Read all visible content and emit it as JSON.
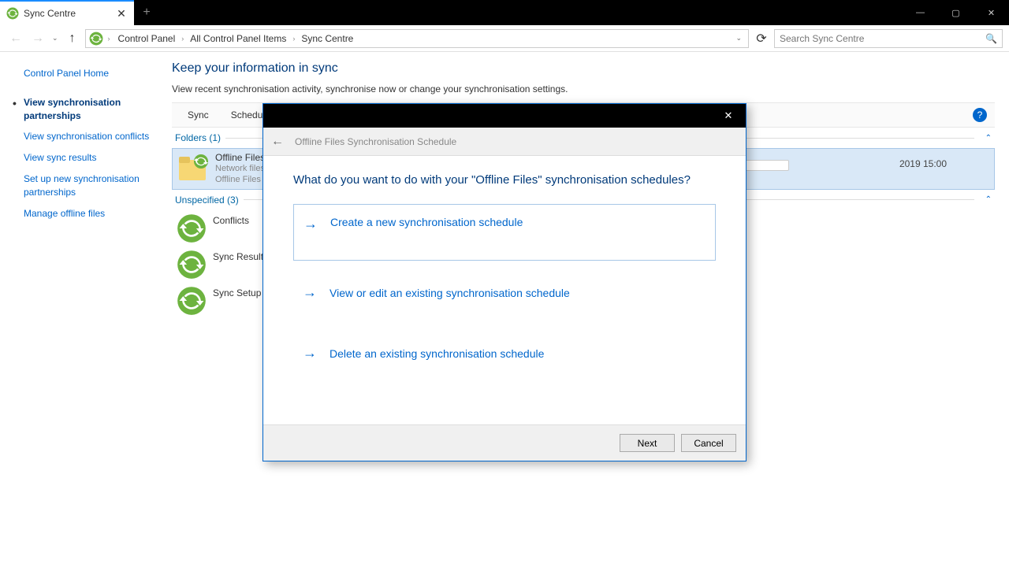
{
  "tab": {
    "title": "Sync Centre"
  },
  "breadcrumb": {
    "a": "Control Panel",
    "b": "All Control Panel Items",
    "c": "Sync Centre"
  },
  "search": {
    "placeholder": "Search Sync Centre"
  },
  "sidebar": {
    "home": "Control Panel Home",
    "links": [
      "View synchronisation partnerships",
      "View synchronisation conflicts",
      "View sync results",
      "Set up new synchronisation partnerships",
      "Manage offline files"
    ]
  },
  "page": {
    "title": "Keep your information in sync",
    "desc": "View recent synchronisation activity, synchronise now or change your synchronisation settings."
  },
  "tabs": {
    "sync": "Sync",
    "schedule": "Schedule"
  },
  "groups": {
    "folders": "Folders (1)",
    "unspecified": "Unspecified (3)"
  },
  "items": {
    "offline": {
      "title": "Offline Files",
      "sub1": "Network files",
      "sub2": "Offline Files a",
      "date": "2019 15:00"
    },
    "conflicts": "Conflicts",
    "results": "Sync Results",
    "setup": "Sync Setup"
  },
  "dialog": {
    "header": "Offline Files Synchronisation Schedule",
    "question": "What do you want to do with your \"Offline Files\" synchronisation schedules?",
    "opt1": "Create a new synchronisation schedule",
    "opt2": "View or edit an existing synchronisation schedule",
    "opt3": "Delete an existing synchronisation schedule",
    "next": "Next",
    "cancel": "Cancel"
  }
}
